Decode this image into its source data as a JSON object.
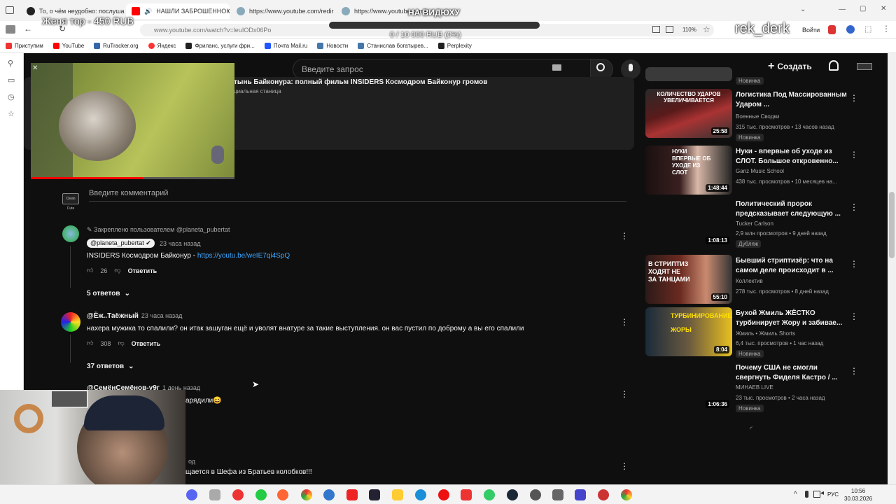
{
  "overlay": {
    "goal_text": "Женя тор - 450 RUB",
    "na_vidyuhu": "НА ВИДЮХУ",
    "progress_text": "0 / 10 000 RUB (0%)",
    "progress_fraction": 0.0,
    "nickname": "rek_derk"
  },
  "browser": {
    "tabs": [
      {
        "title": "То, о чём неудобно: послушайте",
        "active": false
      },
      {
        "title": "НАШЛИ ЗАБРОШЕННОЮ",
        "active": true
      },
      {
        "title": "https://www.youtube.com/redir",
        "active": false
      },
      {
        "title": "https://www.youtube.com/red",
        "active": false
      }
    ],
    "address": "www.youtube.com/watch?v=leuIODx06Po",
    "zoom": "110%",
    "login_label": "Войти",
    "bookmarks": [
      "Приступим",
      "YouTube",
      "RuTracker.org",
      "Яндекс",
      "Фриланс, услуги фри...",
      "Почта Mail.ru",
      "Новости",
      "Станислав богатырев...",
      "Perplexity"
    ]
  },
  "youtube": {
    "search_placeholder": "Введите запрос",
    "create_label": "Создать",
    "video_title": "тынь Байконура: полный фильм INSIDERS Космодром Байконур громов",
    "video_sub": "циальная станица",
    "comment_placeholder": "Введите комментарий",
    "avatar_label": "Clean Cute",
    "comments": [
      {
        "pinned": "Закреплено пользователем @planeta_pubertat",
        "author": "@planeta_pubertat",
        "time": "23 часа назад",
        "text_prefix": "INSIDERS Космодром Байконур - ",
        "link": "https://youtu.be/weIE7qi4SpQ",
        "likes": "26",
        "reply_label": "Ответить",
        "replies": "5 ответов"
      },
      {
        "author": "@Ёж..Таёжный",
        "time": "23 часа назад",
        "text": "нахера мужика то спалили? он итак зашуган ещё и уволят внатуре за такие выступления. он вас пустил по доброму а вы его спалили",
        "likes": "308",
        "reply_label": "Ответить",
        "replies": "37 ответов"
      },
      {
        "author": "@СемёнСемёнов-у9г",
        "time": "1 день назад",
        "text": "арядили😄"
      },
      {
        "time": "од",
        "text": "щается в Шефа из Братьев колобков!!!"
      }
    ],
    "sidebar": [
      {
        "title": "",
        "channel": "",
        "meta": "",
        "badge": "Новинка",
        "duration": ""
      },
      {
        "title": "Логистика Под Массированным Ударом ...",
        "channel": "Военные Сводки",
        "meta": "315 тыс. просмотров • 13 часов назад",
        "badge": "Новинка",
        "duration": "25:58",
        "thumb_text": "КОЛИЧЕСТВО УДАРОВ УВЕЛИЧИВАЕТСЯ"
      },
      {
        "title": "Нуки - впервые об уходе из СЛОТ. Большое откровенно...",
        "channel": "Ganz Music School",
        "meta": "438 тыс. просмотров • 10 месяцев на...",
        "badge": "",
        "duration": "1:48:44",
        "thumb_text": "НУКИ ВПЕРВЫЕ ОБ УХОДЕ ИЗ СЛОТ"
      },
      {
        "title": "Политический пророк предсказывает следующую ...",
        "channel": "Tucker Carlson",
        "meta": "2,9 млн просмотров • 9 дней назад",
        "badge": "Дубляж",
        "duration": "1:08:13",
        "thumb_text": ""
      },
      {
        "title": "Бывший стриптизёр: что на самом деле происходит в ...",
        "channel": "Коллектив",
        "meta": "278 тыс. просмотров • 8 дней назад",
        "badge": "",
        "duration": "55:10",
        "thumb_text": "В СТРИПТИЗ ХОДЯТ НЕ ЗА ТАНЦАМИ"
      },
      {
        "title": "Бухой Жмиль ЖЁСТКО турбинирует Жору и забивае...",
        "channel": "Жмиль • Жмиль Shorts",
        "meta": "6,4 тыс. просмотров • 1 час назад",
        "badge": "Новинка",
        "duration": "8:04",
        "thumb_text": "ТУРБИНИРОВАНИЕ ЖОРЫ"
      },
      {
        "title": "Почему США не смогли свергнуть Фиделя Кастро / ...",
        "channel": "МИНАЕВ LIVE",
        "meta": "23 тыс. просмотров • 2 часа назад",
        "badge": "Новинка",
        "duration": "1:06:36",
        "thumb_text": ""
      }
    ]
  },
  "taskbar": {
    "lang": "РУС",
    "time": "10:56",
    "date": "30.03.2026"
  },
  "colors": {
    "yt_bg": "#0f0f0f",
    "link": "#3ea6ff",
    "accent_red": "#ff0000"
  }
}
